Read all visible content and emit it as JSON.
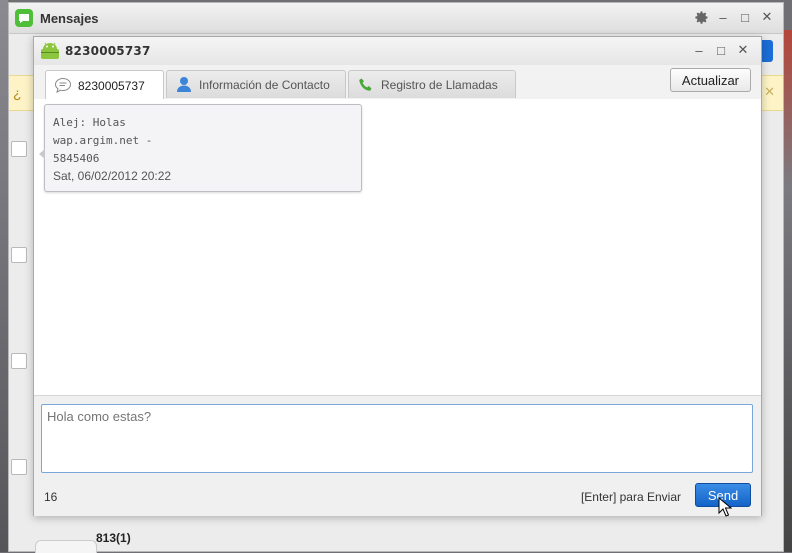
{
  "back_window": {
    "title": "Mensajes",
    "notice_prefix": "¿",
    "bottom_contact": "813(1)"
  },
  "window_controls": {
    "settings_icon": "gear-icon",
    "minimize": "–",
    "maximize": "□",
    "close": "✕"
  },
  "conversation": {
    "title": "8230005737",
    "tabs": [
      {
        "label": "8230005737",
        "icon": "chat-bubble-icon",
        "active": true
      },
      {
        "label": "Información de Contacto",
        "icon": "person-icon",
        "active": false
      },
      {
        "label": "Registro de Llamadas",
        "icon": "phone-icon",
        "active": false
      }
    ],
    "refresh_label": "Actualizar",
    "messages": [
      {
        "text": "Alej: Holas\nwap.argim.net -\n5845406",
        "timestamp": "Sat, 06/02/2012 20:22"
      }
    ],
    "compose": {
      "value": "",
      "placeholder": "Hola como estas?"
    },
    "char_count": "16",
    "enter_hint": "[Enter] para Enviar",
    "send_label": "Send"
  },
  "colors": {
    "accent_blue": "#1b6ed6",
    "brand_green": "#4fbf3a",
    "android_green": "#8cc63f"
  }
}
